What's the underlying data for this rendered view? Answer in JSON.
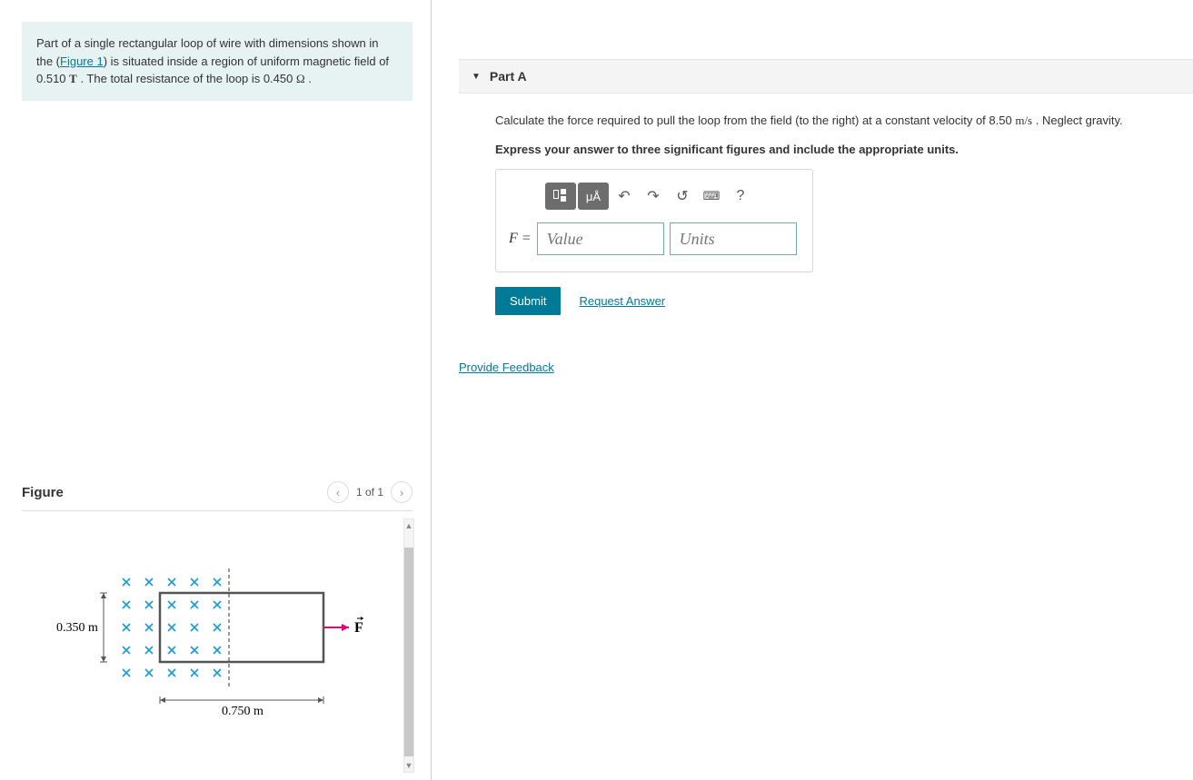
{
  "problem": {
    "intro": "Part of a single rectangular loop of wire with dimensions shown in the (",
    "figure_link": "Figure 1",
    "intro2": ") is situated inside a region of uniform magnetic field of 0.510 ",
    "unit1": "T",
    "intro3": " . The total resistance of the loop is 0.450 ",
    "unit2": "Ω",
    "intro4": " ."
  },
  "figure": {
    "title": "Figure",
    "pager": "1 of 1",
    "height_label": "0.350 m",
    "width_label": "0.750 m",
    "force_label": "F"
  },
  "partA": {
    "title": "Part A",
    "q1": "Calculate the force required to pull the loop from the field (to the right) at a constant velocity of 8.50 ",
    "q1_unit": "m/s",
    "q1b": " . Neglect gravity.",
    "instruction": "Express your answer to three significant figures and include the appropriate units.",
    "var_label": "F = ",
    "value_placeholder": "Value",
    "units_placeholder": "Units",
    "submit": "Submit",
    "request": "Request Answer",
    "toolbar_units": "μÅ",
    "toolbar_help": "?"
  },
  "feedback_link": "Provide Feedback",
  "chart_data": {
    "type": "diagram",
    "description": "Rectangular wire loop partially in uniform magnetic field (into page) with force F pulling right",
    "loop_height_m": 0.35,
    "loop_width_m": 0.75,
    "magnetic_field_T": 0.51,
    "resistance_ohm": 0.45,
    "velocity_m_per_s": 8.5,
    "field_direction": "into_page"
  }
}
